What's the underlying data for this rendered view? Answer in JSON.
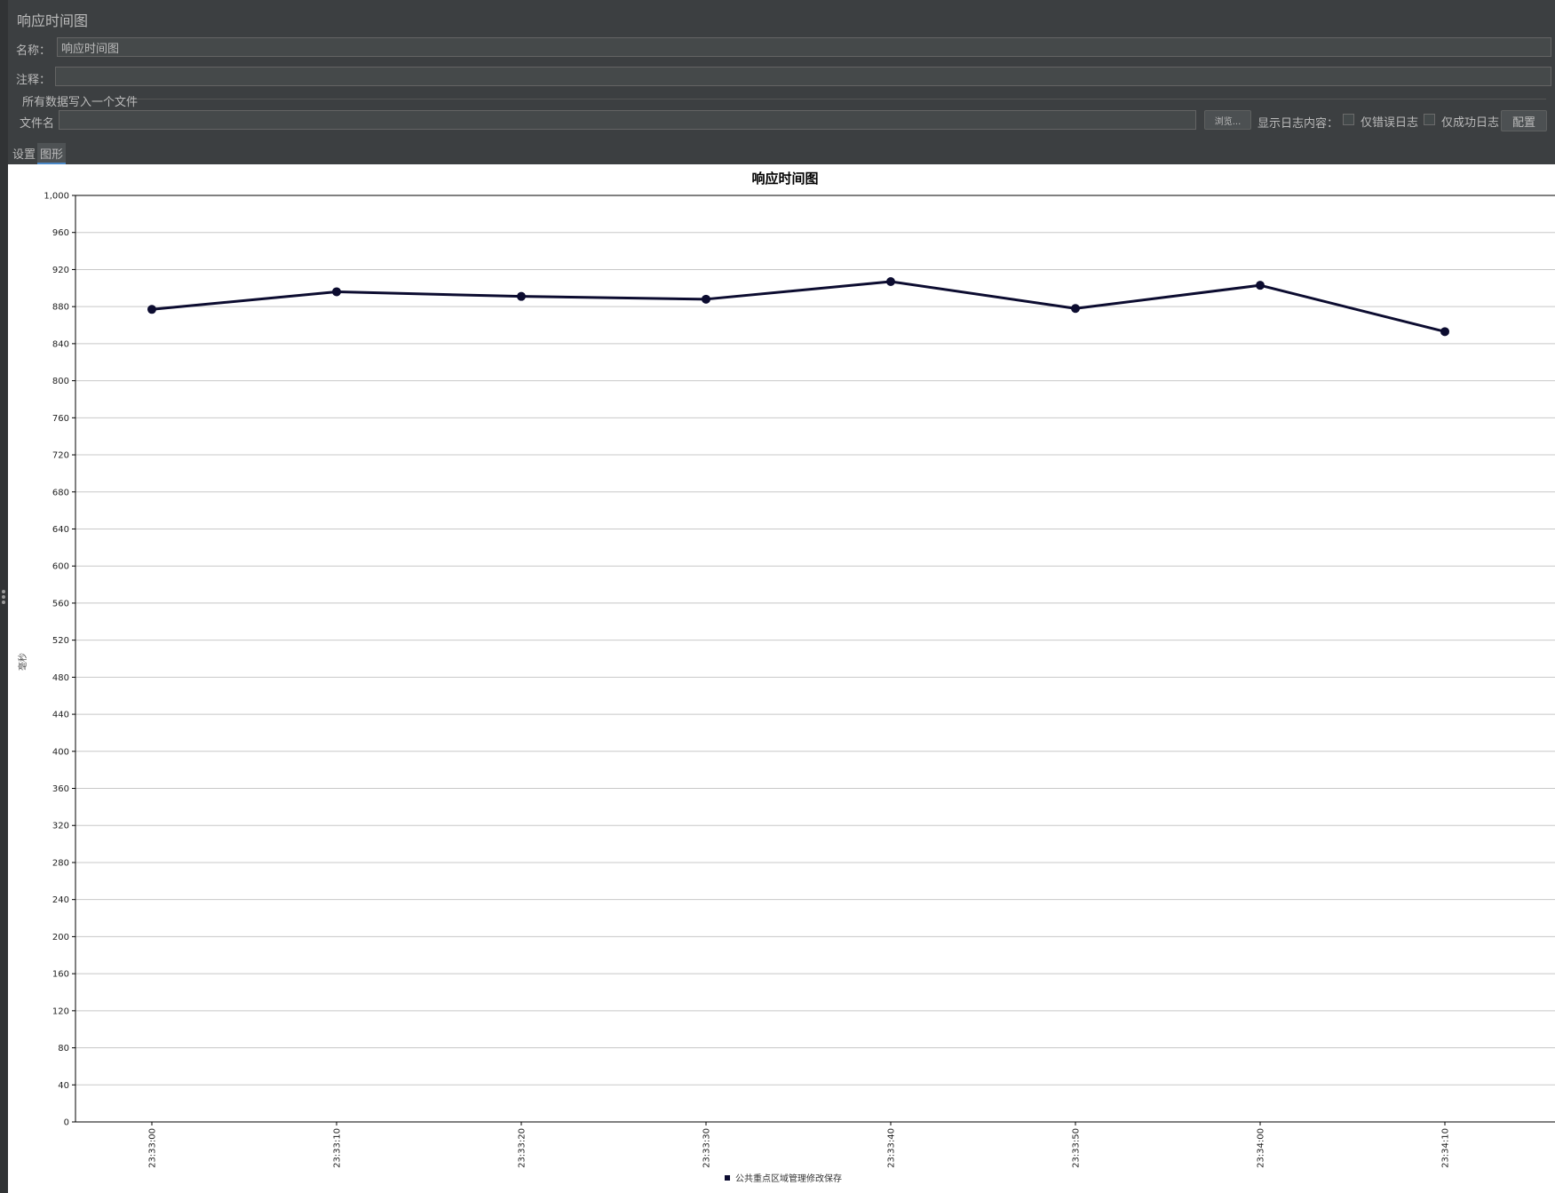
{
  "panel": {
    "title": "响应时间图"
  },
  "form": {
    "name_label": "名称：",
    "name_value": "响应时间图",
    "comment_label": "注释：",
    "comment_value": "",
    "group_title": "所有数据写入一个文件",
    "filename_label": "文件名",
    "filename_value": "",
    "browse_label": "浏览...",
    "log_display_label": "显示日志内容：",
    "errors_only_label": "仅错误日志",
    "errors_only_checked": false,
    "success_only_label": "仅成功日志",
    "success_only_checked": false,
    "configure_label": "配置"
  },
  "tabs": [
    {
      "label": "设置",
      "selected": false
    },
    {
      "label": "图形",
      "selected": true
    }
  ],
  "chart_data": {
    "type": "line",
    "title": "响应时间图",
    "ylabel": "毫秒",
    "xlabel": "",
    "x": [
      "23:33:00",
      "23:33:10",
      "23:33:20",
      "23:33:30",
      "23:33:40",
      "23:33:50",
      "23:34:00",
      "23:34:10"
    ],
    "series": [
      {
        "name": "公共重点区域管理修改保存",
        "values": [
          877,
          896,
          891,
          888,
          907,
          878,
          903,
          853
        ]
      }
    ],
    "ylim": [
      0,
      1000
    ],
    "yticks": [
      "0",
      "40",
      "80",
      "120",
      "160",
      "200",
      "240",
      "280",
      "320",
      "360",
      "400",
      "440",
      "480",
      "520",
      "560",
      "600",
      "640",
      "680",
      "720",
      "760",
      "800",
      "840",
      "880",
      "920",
      "960",
      "1,000"
    ],
    "grid": true,
    "legend": "bottom",
    "colors": {
      "series": "#0c0c30",
      "grid": "#c8c8c8",
      "axis": "#000000",
      "background": "#ffffff"
    }
  }
}
